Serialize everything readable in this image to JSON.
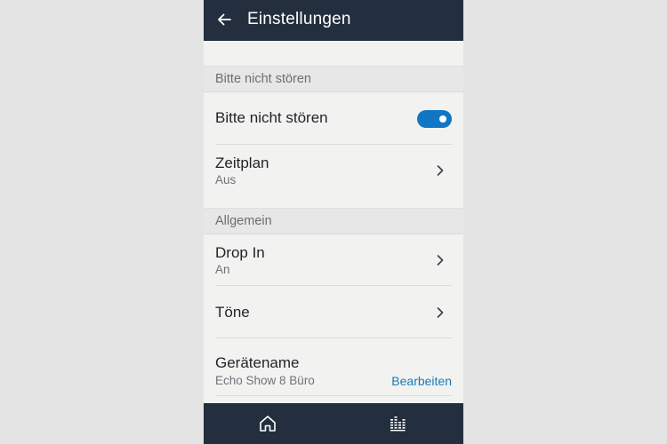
{
  "app_bar": {
    "title": "Einstellungen",
    "back_icon": "arrow-left-icon"
  },
  "sections": {
    "dnd": {
      "header": "Bitte nicht stören",
      "toggle_row": {
        "label": "Bitte nicht stören",
        "enabled": true
      },
      "schedule_row": {
        "label": "Zeitplan",
        "value": "Aus"
      }
    },
    "general": {
      "header": "Allgemein",
      "drop_in_row": {
        "label": "Drop In",
        "value": "An"
      },
      "tones_row": {
        "label": "Töne"
      },
      "device_name_row": {
        "label": "Gerätename",
        "value": "Echo Show 8 Büro",
        "action": "Bearbeiten"
      }
    }
  },
  "bottom_nav": {
    "items": [
      "home-icon",
      "equalizer-icon"
    ]
  },
  "colors": {
    "app_bar_bg": "#232f3e",
    "accent": "#1177c4",
    "link": "#1a7ab8",
    "page_bg": "#e4e4e5"
  }
}
